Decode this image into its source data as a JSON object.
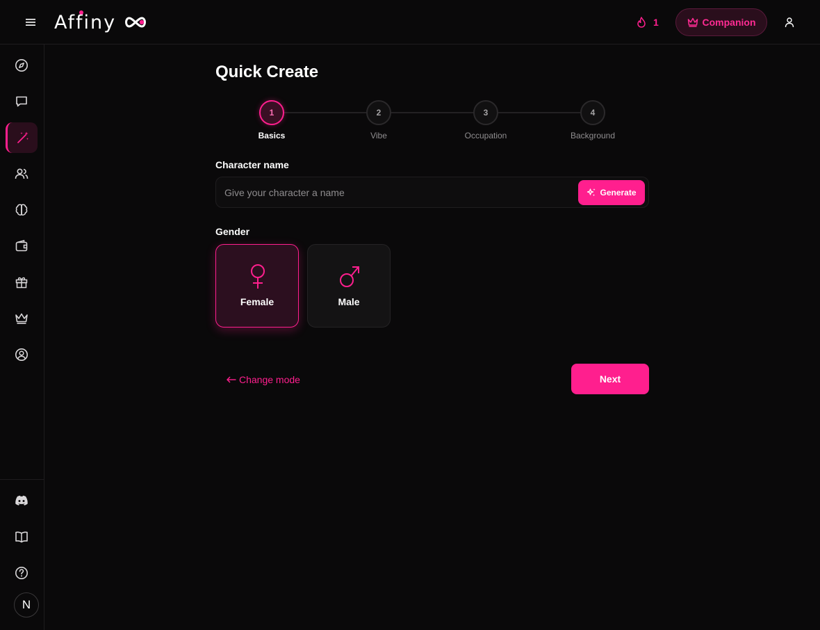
{
  "header": {
    "logo_text": "Affiny",
    "streak_count": "1",
    "companion_label": "Companion"
  },
  "sidebar": {
    "items": [
      {
        "icon": "compass-icon"
      },
      {
        "icon": "chat-icon"
      },
      {
        "icon": "magic-wand-icon",
        "active": true
      },
      {
        "icon": "users-icon"
      },
      {
        "icon": "brain-icon"
      },
      {
        "icon": "wallet-icon"
      },
      {
        "icon": "gift-icon"
      },
      {
        "icon": "crown-icon"
      },
      {
        "icon": "user-circle-icon"
      }
    ],
    "bottom_items": [
      {
        "icon": "discord-icon"
      },
      {
        "icon": "book-icon"
      },
      {
        "icon": "help-icon"
      }
    ],
    "avatar_letter": "N"
  },
  "main": {
    "title": "Quick Create",
    "steps": [
      {
        "number": "1",
        "label": "Basics",
        "active": true
      },
      {
        "number": "2",
        "label": "Vibe"
      },
      {
        "number": "3",
        "label": "Occupation"
      },
      {
        "number": "4",
        "label": "Background"
      }
    ],
    "character_name": {
      "label": "Character name",
      "value": "",
      "placeholder": "Give your character a name",
      "generate_label": "Generate"
    },
    "gender": {
      "label": "Gender",
      "options": [
        {
          "label": "Female",
          "icon": "female-symbol-icon",
          "selected": true
        },
        {
          "label": "Male",
          "icon": "male-symbol-icon",
          "selected": false
        }
      ]
    },
    "change_mode_label": "Change mode",
    "next_label": "Next"
  },
  "colors": {
    "accent": "#ff1f8e",
    "background": "#0a090a",
    "card": "#141314"
  }
}
